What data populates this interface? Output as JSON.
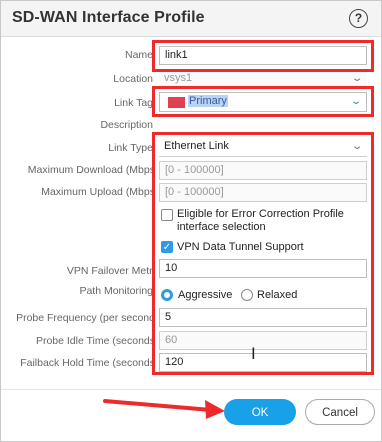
{
  "dialog": {
    "title": "SD-WAN Interface Profile",
    "help_icon": "?",
    "help_icon_name": "help-icon"
  },
  "fields": {
    "name": {
      "label": "Name",
      "value": "link1"
    },
    "location": {
      "label": "Location",
      "value": "vsys1"
    },
    "link_tag": {
      "label": "Link Tag",
      "value": "Primary",
      "color": "#e0404f"
    },
    "description": {
      "label": "Description",
      "value": ""
    },
    "link_type": {
      "label": "Link Type",
      "value": "Ethernet Link"
    },
    "max_download": {
      "label": "Maximum Download (Mbps",
      "placeholder": "[0 - 100000]"
    },
    "max_upload": {
      "label": "Maximum Upload (Mbps",
      "placeholder": "[0 - 100000]"
    },
    "error_correction": {
      "label": "Eligible for Error Correction Profile interface selection",
      "checked": false
    },
    "vpn_tunnel": {
      "label": "VPN Data Tunnel Support",
      "checked": true
    },
    "vpn_failover": {
      "label": "VPN Failover Metri",
      "value": "10"
    },
    "path_monitoring": {
      "label": "Path Monitoring",
      "options": [
        "Aggressive",
        "Relaxed"
      ],
      "selected": "Aggressive"
    },
    "probe_frequency": {
      "label": "Probe Frequency (per second",
      "value": "5"
    },
    "probe_idle": {
      "label": "Probe Idle Time (seconds",
      "value": "60"
    },
    "failback_hold": {
      "label": "Failback Hold Time (seconds",
      "value": "120"
    }
  },
  "buttons": {
    "ok": "OK",
    "cancel": "Cancel"
  },
  "colors": {
    "accent": "#18a0e8",
    "annotation": "#ee2a2a"
  }
}
